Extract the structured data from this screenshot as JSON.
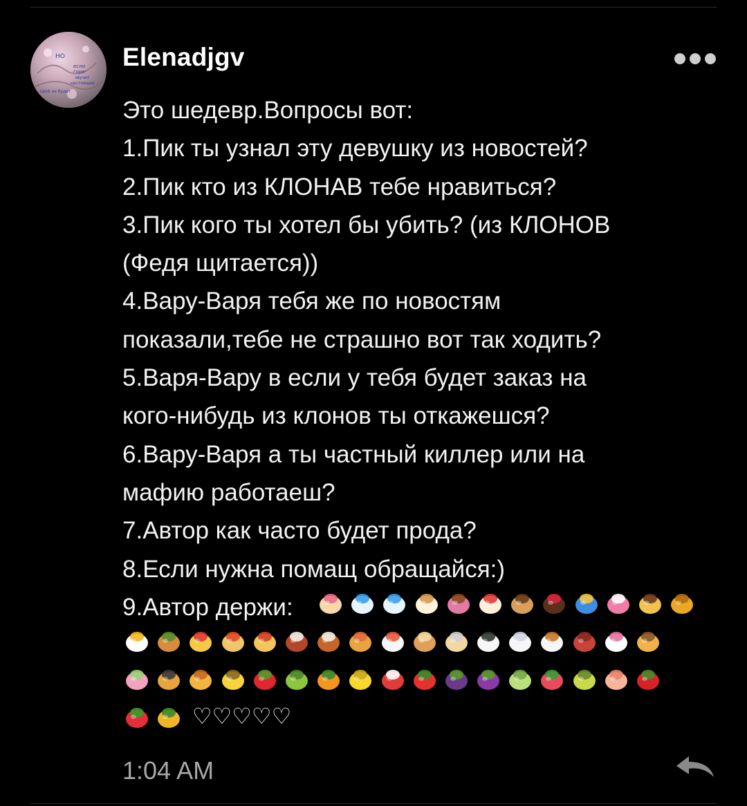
{
  "comment": {
    "username": "Elenadjgv",
    "avatar_text": [
      "НО",
      "если",
      "горе-",
      "звучит",
      "настоящее",
      "свой не будет"
    ],
    "message_lines": [
      "Это шедевр.Вопросы вот:",
      "1.Пик ты узнал эту девушку из новостей?",
      "2.Пик кто из КЛОНАВ тебе нравиться?",
      "3.Пик кого ты хотел бы убить? (из КЛОНОВ",
      "(Федя щитается))",
      "4.Вару-Варя тебя же по новостям",
      "показали,тебе не страшно вот так ходить?",
      "5.Варя-Вару в если у тебя будет заказ на",
      "кого-нибудь из клонов ты откажешся?",
      "6.Вару-Варя а ты частный киллер или на",
      "мафию работаеш?",
      "7.Автор как часто будет прода?",
      "8.Если нужна помащ обращайся:)",
      "9.Автор держи:"
    ],
    "hearts": "♡♡♡♡♡",
    "timestamp": "1:04 AM"
  },
  "emoji_rows": [
    [
      "birthday-cake",
      "shaved-ice",
      "shaved-ice",
      "ice-cream-cone",
      "doughnut",
      "cake-slice",
      "cookie",
      "chocolate-bar",
      "candy",
      "lollipop",
      "custard-pudding",
      "honey-pot"
    ],
    [
      "fried-egg",
      "hamburger",
      "french-fries",
      "spaghetti",
      "pizza",
      "meat-on-bone",
      "poultry-leg",
      "fried-shrimp",
      "sushi",
      "bread",
      "ramen",
      "rice-ball",
      "rice",
      "curry-rice",
      "stew",
      "fish-cake",
      "oden"
    ],
    [
      "dango",
      "rice-cracker",
      "roasted-sweet-potato",
      "banana",
      "red-apple",
      "green-apple",
      "tangerine",
      "lemon",
      "mushroom",
      "tomato",
      "eggplant",
      "grapes",
      "melon",
      "watermelon",
      "pear",
      "peach",
      "cherries"
    ],
    [
      "strawberry",
      "pineapple"
    ]
  ],
  "colors": {
    "background": "#000000",
    "text": "#f2f2f2",
    "timestamp": "#a8a8a8",
    "divider": "#2a2a2a"
  }
}
